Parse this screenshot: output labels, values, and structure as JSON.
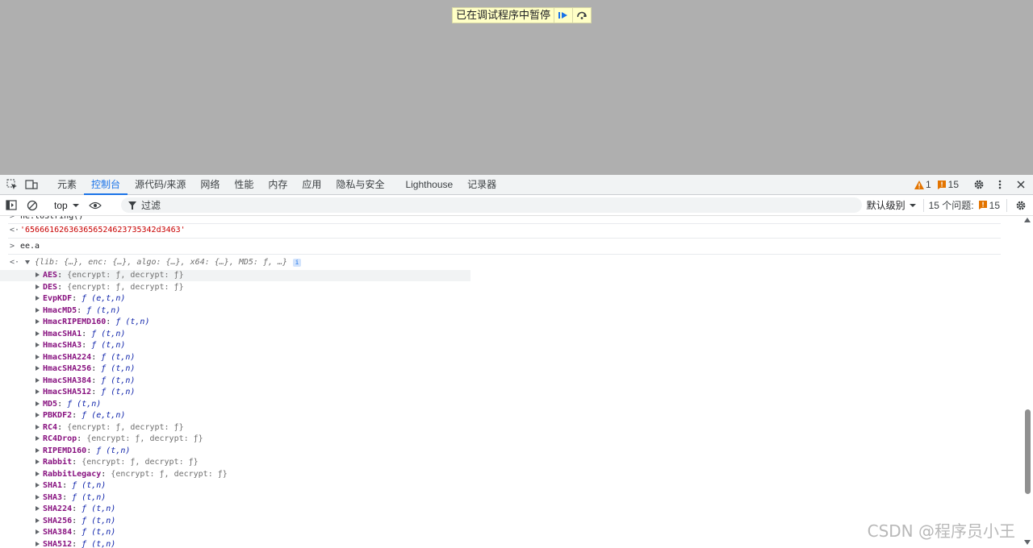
{
  "banner": {
    "text": "已在调试程序中暂停"
  },
  "tabs": [
    "元素",
    "控制台",
    "源代码/来源",
    "网络",
    "性能",
    "内存",
    "应用",
    "隐私与安全",
    "Lighthouse",
    "记录器"
  ],
  "active_tab": "控制台",
  "issues_bar": {
    "warnings": "1",
    "errors": "15"
  },
  "toolbar": {
    "context": "top",
    "filter_placeholder": "过滤",
    "level": "默认级别",
    "issues_label": "15 个问题:",
    "issues_count": "15"
  },
  "console": {
    "line1_input": "ne.toString()",
    "line1_output": "'656661626363656524623735342d3463'",
    "line2_input": "ee.a",
    "line3_summary": "{lib: {…}, enc: {…}, algo: {…}, x64: {…}, MD5: ƒ, …}",
    "props": [
      {
        "key": "AES",
        "val": "{encrypt: ƒ, decrypt: ƒ}",
        "kind": "obj"
      },
      {
        "key": "DES",
        "val": "{encrypt: ƒ, decrypt: ƒ}",
        "kind": "obj"
      },
      {
        "key": "EvpKDF",
        "val": "ƒ (e,t,n)",
        "kind": "fn"
      },
      {
        "key": "HmacMD5",
        "val": "ƒ (t,n)",
        "kind": "fn"
      },
      {
        "key": "HmacRIPEMD160",
        "val": "ƒ (t,n)",
        "kind": "fn"
      },
      {
        "key": "HmacSHA1",
        "val": "ƒ (t,n)",
        "kind": "fn"
      },
      {
        "key": "HmacSHA3",
        "val": "ƒ (t,n)",
        "kind": "fn"
      },
      {
        "key": "HmacSHA224",
        "val": "ƒ (t,n)",
        "kind": "fn"
      },
      {
        "key": "HmacSHA256",
        "val": "ƒ (t,n)",
        "kind": "fn"
      },
      {
        "key": "HmacSHA384",
        "val": "ƒ (t,n)",
        "kind": "fn"
      },
      {
        "key": "HmacSHA512",
        "val": "ƒ (t,n)",
        "kind": "fn"
      },
      {
        "key": "MD5",
        "val": "ƒ (t,n)",
        "kind": "fn"
      },
      {
        "key": "PBKDF2",
        "val": "ƒ (e,t,n)",
        "kind": "fn"
      },
      {
        "key": "RC4",
        "val": "{encrypt: ƒ, decrypt: ƒ}",
        "kind": "obj"
      },
      {
        "key": "RC4Drop",
        "val": "{encrypt: ƒ, decrypt: ƒ}",
        "kind": "obj"
      },
      {
        "key": "RIPEMD160",
        "val": "ƒ (t,n)",
        "kind": "fn"
      },
      {
        "key": "Rabbit",
        "val": "{encrypt: ƒ, decrypt: ƒ}",
        "kind": "obj"
      },
      {
        "key": "RabbitLegacy",
        "val": "{encrypt: ƒ, decrypt: ƒ}",
        "kind": "obj"
      },
      {
        "key": "SHA1",
        "val": "ƒ (t,n)",
        "kind": "fn"
      },
      {
        "key": "SHA3",
        "val": "ƒ (t,n)",
        "kind": "fn"
      },
      {
        "key": "SHA224",
        "val": "ƒ (t,n)",
        "kind": "fn"
      },
      {
        "key": "SHA256",
        "val": "ƒ (t,n)",
        "kind": "fn"
      },
      {
        "key": "SHA384",
        "val": "ƒ (t,n)",
        "kind": "fn"
      },
      {
        "key": "SHA512",
        "val": "ƒ (t,n)",
        "kind": "fn"
      }
    ]
  },
  "watermark": "CSDN @程序员小王"
}
